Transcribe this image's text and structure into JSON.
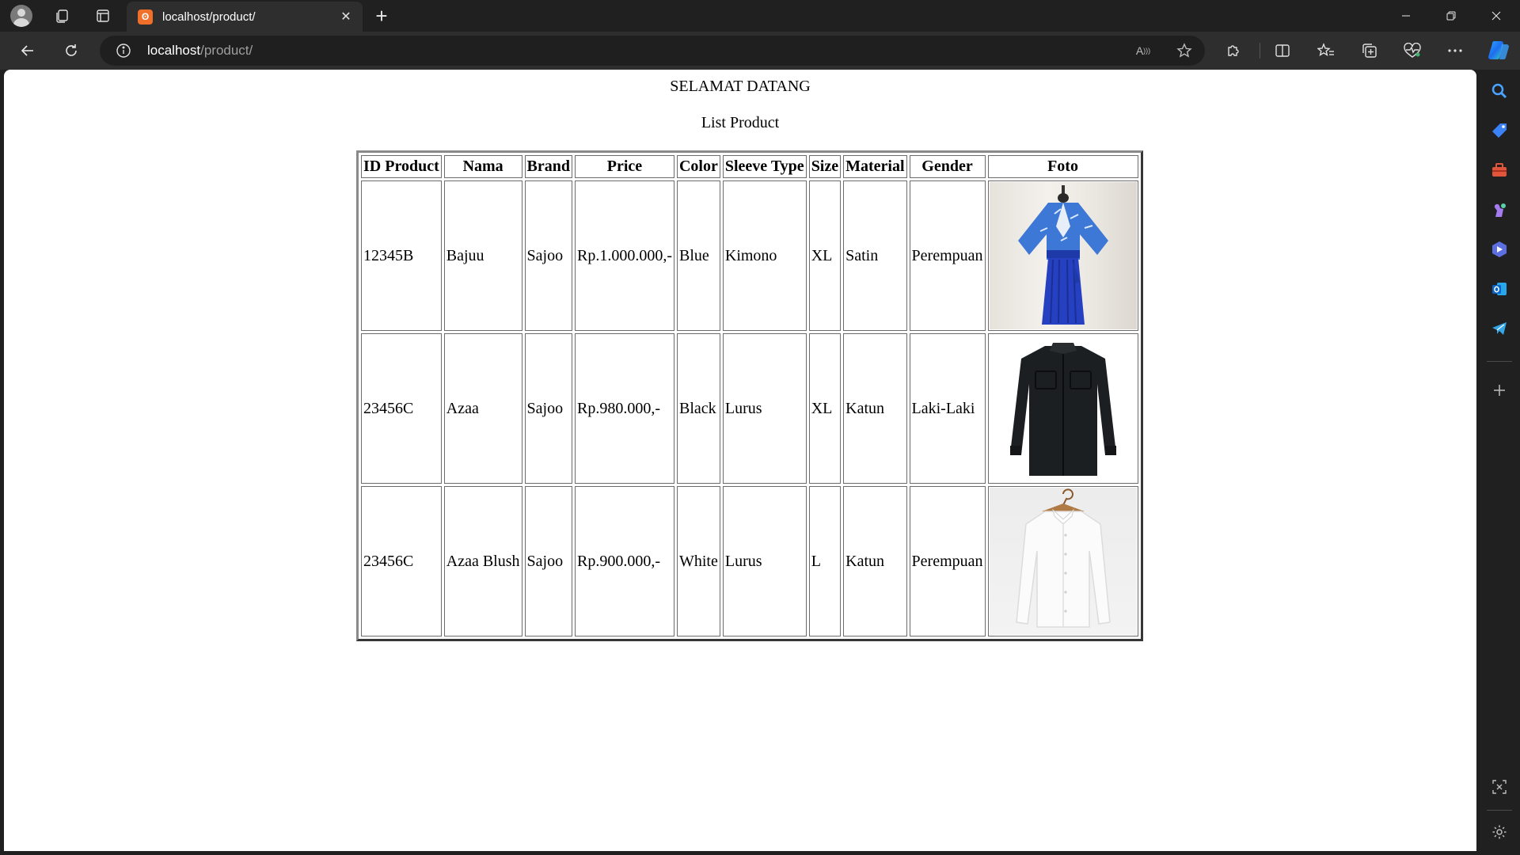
{
  "browser": {
    "tab": {
      "title": "localhost/product/",
      "favicon": "xampp-icon",
      "close_glyph": "✕"
    },
    "new_tab_glyph": "+",
    "address": {
      "host": "localhost",
      "path": "/product/"
    },
    "read_aloud_label": "A",
    "window_controls": {
      "minimize": "—",
      "maximize": "❐",
      "close": "✕"
    },
    "accent": "#f0702a"
  },
  "page": {
    "welcome": "SELAMAT DATANG",
    "list_title": "List Product",
    "table": {
      "headers": [
        "ID Product",
        "Nama",
        "Brand",
        "Price",
        "Color",
        "Sleeve Type",
        "Size",
        "Material",
        "Gender",
        "Foto"
      ],
      "rows": [
        {
          "id": "12345B",
          "nama": "Bajuu",
          "brand": "Sajoo",
          "price": "Rp.1.000.000,-",
          "color": "Blue",
          "sleeve": "Kimono",
          "size": "XL",
          "material": "Satin",
          "gender": "Perempuan",
          "photo": "blue-kimono-dress-photo"
        },
        {
          "id": "23456C",
          "nama": "Azaa",
          "brand": "Sajoo",
          "price": "Rp.980.000,-",
          "color": "Black",
          "sleeve": "Lurus",
          "size": "XL",
          "material": "Katun",
          "gender": "Laki-Laki",
          "photo": "black-long-sleeve-shirt-photo"
        },
        {
          "id": "23456C",
          "nama": "Azaa Blush",
          "brand": "Sajoo",
          "price": "Rp.900.000,-",
          "color": "White",
          "sleeve": "Lurus",
          "size": "L",
          "material": "Katun",
          "gender": "Perempuan",
          "photo": "white-blouse-on-hanger-photo"
        }
      ]
    }
  },
  "sidebar": {
    "icons": [
      "search-icon",
      "shopping-tag-icon",
      "toolbox-icon",
      "games-icon",
      "copilot-app-icon",
      "outlook-icon",
      "telegram-icon",
      "add-icon",
      "screenshot-icon",
      "settings-icon"
    ]
  }
}
